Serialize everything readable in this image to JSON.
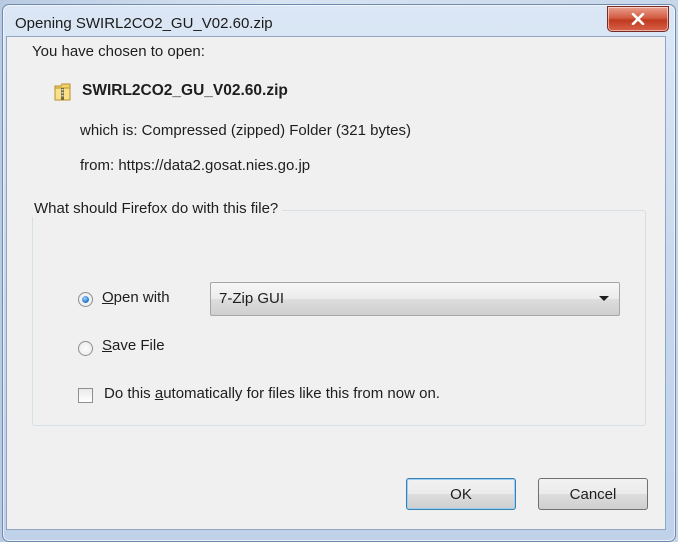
{
  "window": {
    "title": "Opening SWIRL2CO2_GU_V02.60.zip",
    "close_label": "X"
  },
  "dialog": {
    "intro": "You have chosen to open:",
    "file_icon": "zip-folder-icon",
    "file_name": "SWIRL2CO2_GU_V02.60.zip",
    "which_is": "which is: Compressed (zipped) Folder (321 bytes)",
    "from": "from: https://data2.gosat.nies.go.jp"
  },
  "action_group": {
    "legend": "What should Firefox do with this file?",
    "open_with": {
      "accel": "O",
      "rest": "pen with",
      "selected": true
    },
    "app_select": {
      "value": "7-Zip GUI"
    },
    "save_file": {
      "accel": "S",
      "rest": "ave File",
      "selected": false
    },
    "auto_checkbox": {
      "before": "Do this ",
      "accel": "a",
      "after": "utomatically for files like this from now on.",
      "checked": false
    }
  },
  "buttons": {
    "ok": "OK",
    "cancel": "Cancel"
  }
}
